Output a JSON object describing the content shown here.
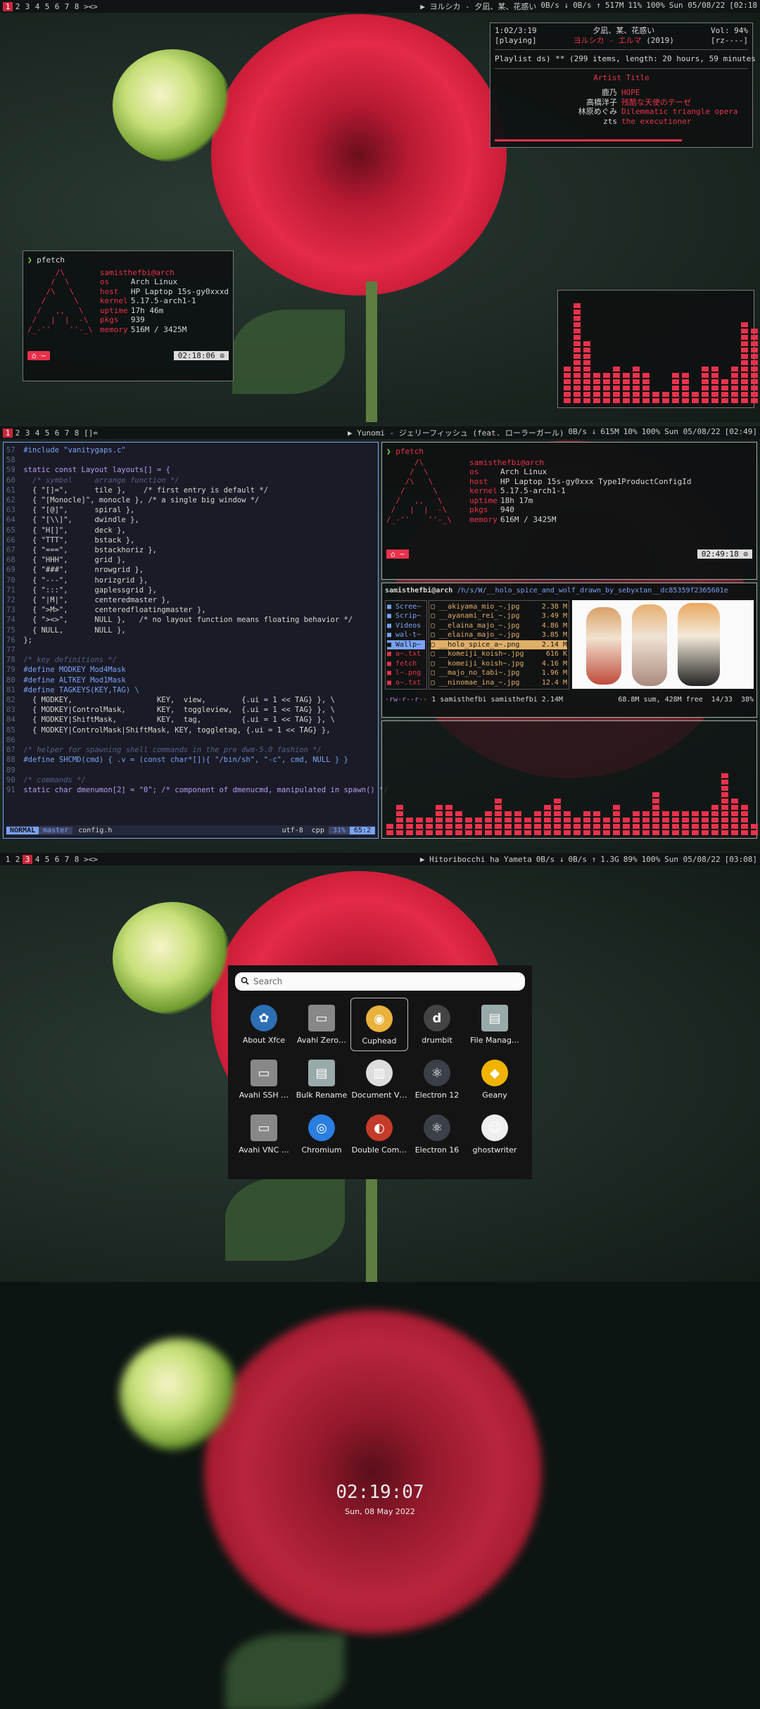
{
  "s1": {
    "bar": {
      "tags": [
        "1",
        "2",
        "3",
        "4",
        "5",
        "6",
        "7",
        "8",
        "><>"
      ],
      "selected": 0,
      "media": "▶ ヨルシカ - 夕凪、某、花惑い",
      "net_down": "0B/s ↓",
      "net_up": "0B/s ↑",
      "mem": "517M",
      "cpu": "11%",
      "bat": "100%",
      "date": "Sun 05/08/22",
      "time": "[02:18"
    },
    "ncmpcpp": {
      "pos": "1:02/3:19",
      "status": "[playing]",
      "title": "夕凪、某、花惑い",
      "artist": "ヨルシカ - エルマ",
      "year": "(2019)",
      "vol": "Vol: 94%",
      "mode": "[rz----]",
      "playlist": "Playlist ds) ** (299 items, length: 20 hours, 59 minutes",
      "header": "Artist Title",
      "rows": [
        [
          "鹿乃",
          "HOPE"
        ],
        [
          "高橋洋子",
          "残酷な天使のテーゼ"
        ],
        [
          "林原めぐみ",
          "Dilemmatic triangle opera"
        ],
        [
          "zts",
          "the executioner"
        ]
      ]
    },
    "pfetch": {
      "cmd": "pfetch",
      "user": "samisthefbi@arch",
      "os": "Arch Linux",
      "host": "HP Laptop 15s-gy0xxxd",
      "kernel": "5.17.5-arch1-1",
      "uptime": "17h 46m",
      "pkgs": "939",
      "memory": "516M / 3425M",
      "prompt_time": "02:18:06 ⊙",
      "home": "⌂ ~"
    }
  },
  "s2": {
    "bar": {
      "tags": [
        "1",
        "2",
        "3",
        "4",
        "5",
        "6",
        "7",
        "8",
        "[]="
      ],
      "selected": 0,
      "media": "▶ Yunomi - ジェリーフィッシュ (feat. ローラーガール)",
      "net_down": "0B/s ↓",
      "mem": "615M",
      "cpu": "10%",
      "bat": "100%",
      "date": "Sun 05/08/22",
      "time": "[02:49]"
    },
    "code": [
      [
        "57",
        "#include \"vanitygaps.c\""
      ],
      [
        "58",
        ""
      ],
      [
        "59",
        "static const Layout layouts[] = {"
      ],
      [
        "60",
        "  /* symbol     arrange function */"
      ],
      [
        "61",
        "  { \"[]=\",      tile },    /* first entry is default */"
      ],
      [
        "62",
        "  { \"[Monocle]\", monocle }, /* a single big window */"
      ],
      [
        "63",
        "  { \"[@]\",      spiral },"
      ],
      [
        "64",
        "  { \"[\\\\]\",     dwindle },"
      ],
      [
        "65",
        "  { \"H[]\",      deck },"
      ],
      [
        "66",
        "  { \"TTT\",      bstack },"
      ],
      [
        "67",
        "  { \"===\",      bstackhoriz },"
      ],
      [
        "68",
        "  { \"HHH\",      grid },"
      ],
      [
        "69",
        "  { \"###\",      nrowgrid },"
      ],
      [
        "70",
        "  { \"---\",      horizgrid },"
      ],
      [
        "71",
        "  { \":::\",      gaplessgrid },"
      ],
      [
        "72",
        "  { \"|M|\",      centeredmaster },"
      ],
      [
        "73",
        "  { \">M>\",      centeredfloatingmaster },"
      ],
      [
        "74",
        "  { \"><>\",      NULL },   /* no layout function means floating behavior */"
      ],
      [
        "75",
        "  { NULL,       NULL },"
      ],
      [
        "76",
        "};"
      ],
      [
        "77",
        ""
      ],
      [
        "78",
        "/* key definitions */"
      ],
      [
        "79",
        "#define MODKEY Mod4Mask"
      ],
      [
        "80",
        "#define ALTKEY Mod1Mask"
      ],
      [
        "81",
        "#define TAGKEYS(KEY,TAG) \\"
      ],
      [
        "82",
        "  { MODKEY,                   KEY,  view,        {.ui = 1 << TAG} }, \\"
      ],
      [
        "83",
        "  { MODKEY|ControlMask,       KEY,  toggleview,  {.ui = 1 << TAG} }, \\"
      ],
      [
        "84",
        "  { MODKEY|ShiftMask,         KEY,  tag,         {.ui = 1 << TAG} }, \\"
      ],
      [
        "85",
        "  { MODKEY|ControlMask|ShiftMask, KEY, toggletag, {.ui = 1 << TAG} },"
      ],
      [
        "86",
        ""
      ],
      [
        "87",
        "/* helper for spawning shell commands in the pre dwm-5.0 fashion */"
      ],
      [
        "88",
        "#define SHCMD(cmd) { .v = (const char*[]){ \"/bin/sh\", \"-c\", cmd, NULL } }"
      ],
      [
        "89",
        ""
      ],
      [
        "90",
        "/* commands */"
      ],
      [
        "91",
        "static char dmenumon[2] = \"0\"; /* component of dmenucmd, manipulated in spawn() */"
      ]
    ],
    "status": {
      "mode": "NORMAL",
      "branch": "master",
      "file": "config.h",
      "enc": "utf-8",
      "ft": "cpp",
      "pct": "31%",
      "pos": "65:2"
    },
    "pfetch": {
      "cmd": "pfetch",
      "user": "samisthefbi@arch",
      "os": "Arch Linux",
      "host": "HP Laptop 15s-gy0xxx Type1ProductConfigId",
      "kernel": "5.17.5-arch1-1",
      "uptime": "18h 17m",
      "pkgs": "940",
      "memory": "616M / 3425M",
      "prompt_time": "02:49:18 ⊙",
      "home": "⌂ ~"
    },
    "lf": {
      "header_user": "samisthefbi@arch",
      "header_path": "/h/s/W/__holo_spice_and_wolf_drawn_by_sebyxtan__dc85359f2365601e",
      "dirs": [
        "Scree~",
        "Scrip~",
        "Videos",
        "wal-t~",
        "Wallp~",
        "a~.txt",
        "fetch",
        "l~.png",
        "o~.txt"
      ],
      "files": [
        [
          "__akiyama_mio_~.jpg",
          "2.38 M"
        ],
        [
          "__ayanami_rei_~.jpg",
          "3.49 M"
        ],
        [
          "__elaina_majo_~.jpg",
          "4.86 M"
        ],
        [
          "__elaina_majo_~.jpg",
          "3.85 M"
        ],
        [
          "__holo_spice_a~.png",
          "2.14 M"
        ],
        [
          "__komeiji_koish~.jpg",
          "616 K"
        ],
        [
          "__komeiji_koish~.jpg",
          "4.16 M"
        ],
        [
          "__majo_no_tabi~.jpg",
          "1.96 M"
        ],
        [
          "__ninomae_ina_~.jpg",
          "12.4 M"
        ]
      ],
      "footer_perm": "-rw-r--r--",
      "footer_info": "1 samisthefbi samisthefbi 2.14M",
      "footer_right": "68.8M sum, 428M free  14/33  38%"
    }
  },
  "s3": {
    "bar": {
      "tags": [
        "1",
        "2",
        "3",
        "4",
        "5",
        "6",
        "7",
        "8",
        "><>"
      ],
      "selected": 2,
      "media": "▶ Hitoribocchi ha Yameta",
      "net_down": "0B/s ↓",
      "net_up": "0B/s ↑",
      "mem": "1.3G",
      "cpu": "89%",
      "bat": "100%",
      "date": "Sun 05/08/22",
      "time": "[03:08]"
    },
    "launcher": {
      "placeholder": "Search",
      "apps": [
        "About Xfce",
        "Avahi Zero…",
        "Cuphead",
        "drumbit",
        "File Manag…",
        "Avahi SSH …",
        "Bulk Rename",
        "Document V…",
        "Electron 12",
        "Geany",
        "Avahi VNC …",
        "Chromium",
        "Double Com…",
        "Electron 16",
        "ghostwriter"
      ]
    }
  },
  "s4": {
    "time": "02:19:07",
    "date": "Sun, 08 May 2022"
  },
  "colors": {
    "accent": "#e8324c",
    "bar": "#101414",
    "vnormal": "#7aa2f7"
  }
}
